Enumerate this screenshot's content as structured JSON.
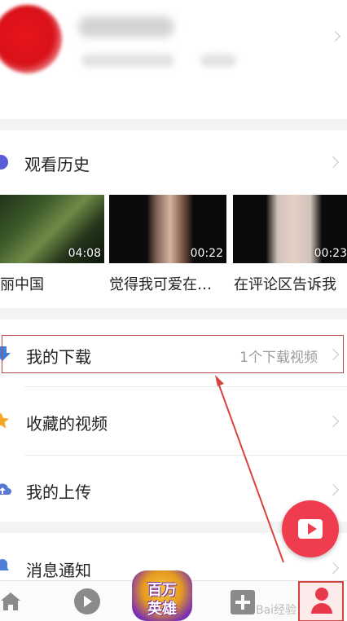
{
  "history": {
    "title": "观看历史",
    "videos": [
      {
        "title": "丽中国",
        "duration": "04:08"
      },
      {
        "title": "觉得我可爱在…",
        "duration": "00:22"
      },
      {
        "title": "在评论区告诉我",
        "duration": "00:23"
      }
    ]
  },
  "menu": {
    "downloads": {
      "label": "我的下载",
      "extra": "1个下载视频"
    },
    "favorites": {
      "label": "收藏的视频"
    },
    "uploads": {
      "label": "我的上传"
    },
    "notifications": {
      "label": "消息通知"
    }
  },
  "promo": {
    "line1": "百万",
    "line2": "英雄"
  },
  "icons": {
    "history": "history-icon",
    "download": "download-icon",
    "favorite": "star-icon",
    "upload": "cloud-upload-icon",
    "notify": "bell-icon",
    "fab": "video-camera-icon",
    "home": "home-icon",
    "play": "play-icon",
    "add": "plus-icon",
    "profile": "user-icon"
  },
  "colors": {
    "accent": "#f03c4f",
    "history_icon": "#5a5bd6",
    "download_icon": "#3f7fd9",
    "favorite_icon": "#f5a623",
    "upload_icon": "#5878d8",
    "annotation": "#b44a4a"
  },
  "watermark": "Bai经验"
}
